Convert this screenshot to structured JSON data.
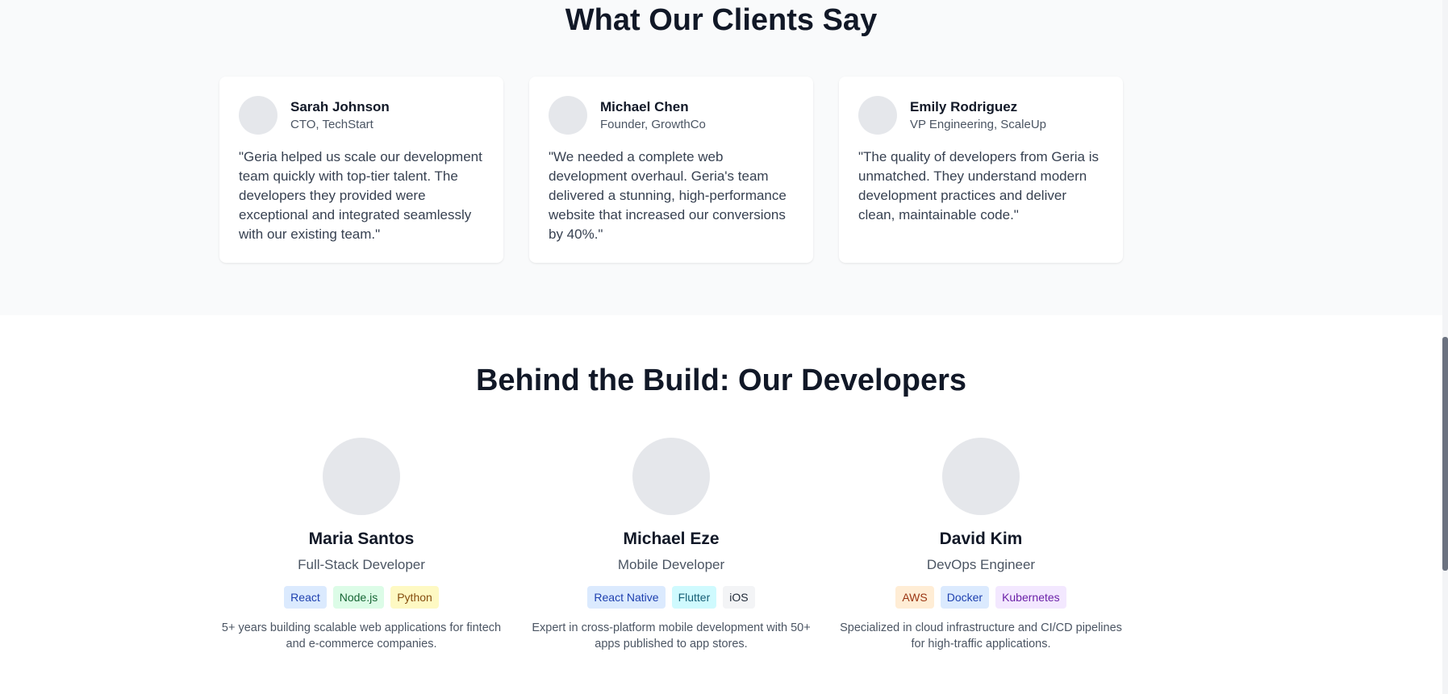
{
  "testimonials": {
    "title": "What Our Clients Say",
    "items": [
      {
        "name": "Sarah Johnson",
        "role": "CTO, TechStart",
        "quote": "\"Geria helped us scale our development team quickly with top-tier talent. The developers they provided were exceptional and integrated seamlessly with our existing team.\""
      },
      {
        "name": "Michael Chen",
        "role": "Founder, GrowthCo",
        "quote": "\"We needed a complete web development overhaul. Geria's team delivered a stunning, high-performance website that increased our conversions by 40%.\""
      },
      {
        "name": "Emily Rodriguez",
        "role": "VP Engineering, ScaleUp",
        "quote": "\"The quality of developers from Geria is unmatched. They understand modern development practices and deliver clean, maintainable code.\""
      }
    ]
  },
  "developers": {
    "title": "Behind the Build: Our Developers",
    "items": [
      {
        "name": "Maria Santos",
        "role": "Full-Stack Developer",
        "tags": [
          "React",
          "Node.js",
          "Python"
        ],
        "bio": "5+ years building scalable web applications for fintech and e-commerce companies."
      },
      {
        "name": "Michael Eze",
        "role": "Mobile Developer",
        "tags": [
          "React Native",
          "Flutter",
          "iOS"
        ],
        "bio": "Expert in cross-platform mobile development with 50+ apps published to app stores."
      },
      {
        "name": "David Kim",
        "role": "DevOps Engineer",
        "tags": [
          "AWS",
          "Docker",
          "Kubernetes"
        ],
        "bio": "Specialized in cloud infrastructure and CI/CD pipelines for high-traffic applications."
      }
    ]
  },
  "tag_colors": {
    "blue": {
      "bg": "#dbeafe",
      "fg": "#1e40af"
    },
    "green": {
      "bg": "#dcfce7",
      "fg": "#166534"
    },
    "yellow": {
      "bg": "#fef9c3",
      "fg": "#854d0e"
    },
    "cyan": {
      "bg": "#cffafe",
      "fg": "#155e75"
    },
    "gray": {
      "bg": "#f3f4f6",
      "fg": "#1f2937"
    },
    "orange": {
      "bg": "#ffedd5",
      "fg": "#9a3412"
    },
    "purple": {
      "bg": "#f3e8ff",
      "fg": "#6b21a8"
    }
  }
}
